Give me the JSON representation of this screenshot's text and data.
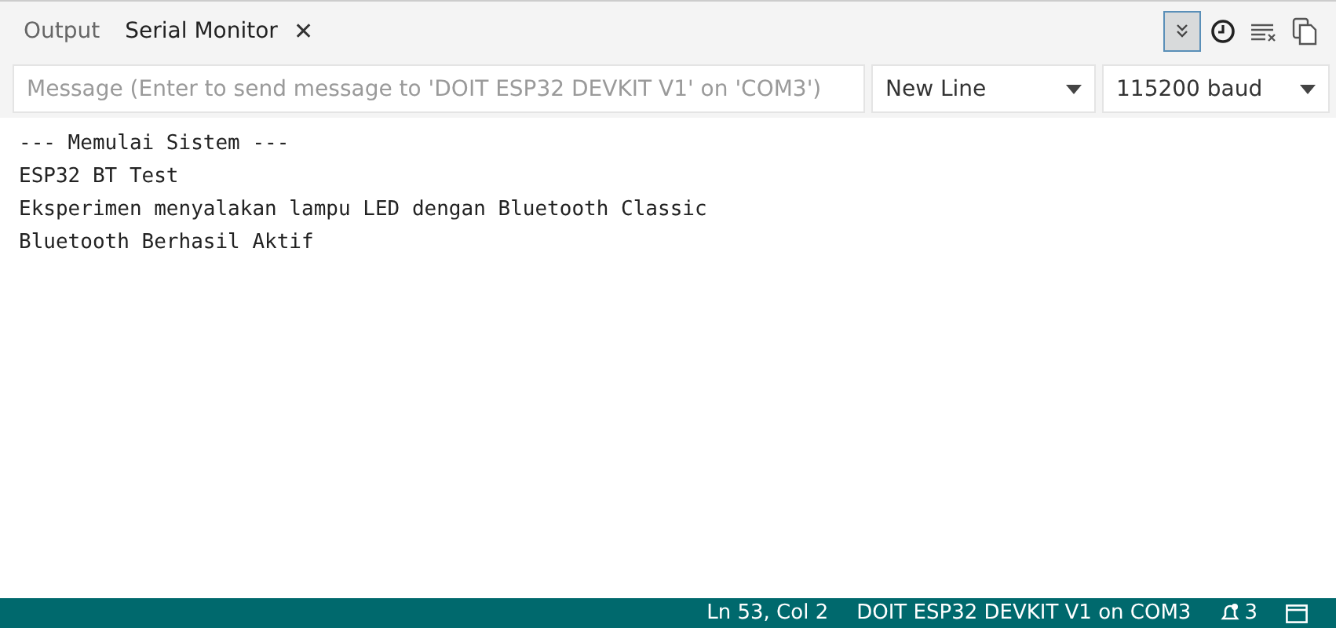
{
  "tabs": [
    {
      "label": "Output",
      "selected": false
    },
    {
      "label": "Serial Monitor",
      "selected": true,
      "close_glyph": "✕"
    }
  ],
  "toolbar": [
    {
      "kind": "autoscroll",
      "on": true
    },
    {
      "kind": "timestamp",
      "on": false
    },
    {
      "kind": "clear"
    },
    {
      "kind": "copy"
    }
  ],
  "message": {
    "placeholder": "Message (Enter to send message to 'DOIT ESP32 DEVKIT V1' on 'COM3')"
  },
  "line_ending": {
    "value": "New Line"
  },
  "baud": {
    "value": "115200 baud"
  },
  "output_lines": [
    "--- Memulai Sistem ---",
    "ESP32 BT Test",
    "Eksperimen menyalakan lampu LED dengan Bluetooth Classic",
    "Bluetooth Berhasil Aktif"
  ],
  "status_bar": {
    "position": "Ln 53, Col 2",
    "board": "DOIT ESP32 DEVKIT V1 on COM3",
    "notifications": "3"
  }
}
